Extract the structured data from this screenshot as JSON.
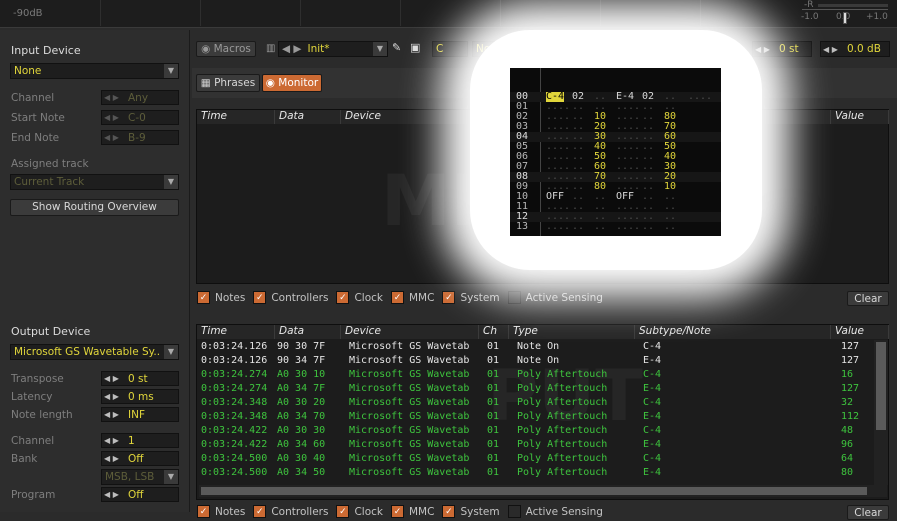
{
  "top_meter": {
    "db_label": "-90dB",
    "vu_labels": [
      "-R",
      "-L",
      "-1.0",
      "0.0",
      "+1.0"
    ]
  },
  "left_panel": {
    "input_device_title": "Input Device",
    "input_device_value": "None",
    "channel_label": "Channel",
    "channel_value": "Any",
    "start_note_label": "Start Note",
    "start_note_value": "C-0",
    "end_note_label": "End Note",
    "end_note_value": "B-9",
    "assigned_track_label": "Assigned track",
    "assigned_track_value": "Current Track",
    "routing_button": "Show Routing Overview",
    "output_device_title": "Output Device",
    "output_device_value": "Microsoft GS Wavetable Sy..",
    "transpose_label": "Transpose",
    "transpose_value": "0 st",
    "latency_label": "Latency",
    "latency_value": "0 ms",
    "note_length_label": "Note length",
    "note_length_value": "INF",
    "out_channel_label": "Channel",
    "out_channel_value": "1",
    "bank_label": "Bank",
    "bank_value": "Off",
    "bank_mode_value": "MSB, LSB",
    "program_label": "Program",
    "program_value": "Off"
  },
  "toolbar": {
    "macros_label": "Macros",
    "preset_value": "Init*",
    "key_value": "C",
    "scale_value": "No scale",
    "transpose_value": "0 st",
    "volume_value": "0.0 dB"
  },
  "tabs": {
    "phrases": "Phrases",
    "monitor": "Monitor"
  },
  "input_table": {
    "columns": [
      "Time",
      "Data",
      "Device",
      "Ch",
      "Value"
    ],
    "watermark": "MI"
  },
  "filters": {
    "items": [
      {
        "label": "Notes",
        "checked": true
      },
      {
        "label": "Controllers",
        "checked": true
      },
      {
        "label": "Clock",
        "checked": true
      },
      {
        "label": "MMC",
        "checked": true
      },
      {
        "label": "System",
        "checked": true
      },
      {
        "label": "Active Sensing",
        "checked": false
      }
    ],
    "clear_label": "Clear"
  },
  "output_table": {
    "columns": [
      "Time",
      "Data",
      "Device",
      "Ch",
      "Type",
      "Subtype/Note",
      "Value"
    ],
    "watermark": "PUT",
    "rows": [
      {
        "time": "0:03:24.126",
        "data": "90 30 7F",
        "device": "Microsoft GS Wavetab",
        "ch": "01",
        "type": "Note On",
        "sub": "C-4",
        "value": "127",
        "color": "#e6e6e6"
      },
      {
        "time": "0:03:24.126",
        "data": "90 34 7F",
        "device": "Microsoft GS Wavetab",
        "ch": "01",
        "type": "Note On",
        "sub": "E-4",
        "value": "127",
        "color": "#e6e6e6"
      },
      {
        "time": "0:03:24.274",
        "data": "A0 30 10",
        "device": "Microsoft GS Wavetab",
        "ch": "01",
        "type": "Poly Aftertouch",
        "sub": "C-4",
        "value": "16",
        "color": "#3ec43e"
      },
      {
        "time": "0:03:24.274",
        "data": "A0 34 7F",
        "device": "Microsoft GS Wavetab",
        "ch": "01",
        "type": "Poly Aftertouch",
        "sub": "E-4",
        "value": "127",
        "color": "#3ec43e"
      },
      {
        "time": "0:03:24.348",
        "data": "A0 30 20",
        "device": "Microsoft GS Wavetab",
        "ch": "01",
        "type": "Poly Aftertouch",
        "sub": "C-4",
        "value": "32",
        "color": "#3ec43e"
      },
      {
        "time": "0:03:24.348",
        "data": "A0 34 70",
        "device": "Microsoft GS Wavetab",
        "ch": "01",
        "type": "Poly Aftertouch",
        "sub": "E-4",
        "value": "112",
        "color": "#3ec43e"
      },
      {
        "time": "0:03:24.422",
        "data": "A0 30 30",
        "device": "Microsoft GS Wavetab",
        "ch": "01",
        "type": "Poly Aftertouch",
        "sub": "C-4",
        "value": "48",
        "color": "#3ec43e"
      },
      {
        "time": "0:03:24.422",
        "data": "A0 34 60",
        "device": "Microsoft GS Wavetab",
        "ch": "01",
        "type": "Poly Aftertouch",
        "sub": "E-4",
        "value": "96",
        "color": "#3ec43e"
      },
      {
        "time": "0:03:24.500",
        "data": "A0 30 40",
        "device": "Microsoft GS Wavetab",
        "ch": "01",
        "type": "Poly Aftertouch",
        "sub": "C-4",
        "value": "64",
        "color": "#3ec43e"
      },
      {
        "time": "0:03:24.500",
        "data": "A0 34 50",
        "device": "Microsoft GS Wavetab",
        "ch": "01",
        "type": "Poly Aftertouch",
        "sub": "E-4",
        "value": "80",
        "color": "#3ec43e"
      }
    ]
  },
  "bottom_clear_label": "Clear",
  "tracker": {
    "rows": [
      {
        "n": "00",
        "a": "C-4",
        "b": "02",
        "c": "..",
        "d": "E-4",
        "e": "02",
        "f": "..",
        "g": "....",
        "hl": true
      },
      {
        "n": "01",
        "a": "....",
        "b": "..",
        "c": "..",
        "d": "....",
        "e": "..",
        "f": "..",
        "g": ""
      },
      {
        "n": "02",
        "a": "....",
        "b": "..",
        "c": "10",
        "d": "....",
        "e": "..",
        "f": "80",
        "g": ""
      },
      {
        "n": "03",
        "a": "....",
        "b": "..",
        "c": "20",
        "d": "....",
        "e": "..",
        "f": "70",
        "g": ""
      },
      {
        "n": "04",
        "a": "....",
        "b": "..",
        "c": "30",
        "d": "....",
        "e": "..",
        "f": "60",
        "g": ""
      },
      {
        "n": "05",
        "a": "....",
        "b": "..",
        "c": "40",
        "d": "....",
        "e": "..",
        "f": "50",
        "g": ""
      },
      {
        "n": "06",
        "a": "....",
        "b": "..",
        "c": "50",
        "d": "....",
        "e": "..",
        "f": "40",
        "g": ""
      },
      {
        "n": "07",
        "a": "....",
        "b": "..",
        "c": "60",
        "d": "....",
        "e": "..",
        "f": "30",
        "g": ""
      },
      {
        "n": "08",
        "a": "....",
        "b": "..",
        "c": "70",
        "d": "....",
        "e": "..",
        "f": "20",
        "g": ""
      },
      {
        "n": "09",
        "a": "....",
        "b": "..",
        "c": "80",
        "d": "....",
        "e": "..",
        "f": "10",
        "g": ""
      },
      {
        "n": "10",
        "a": "OFF",
        "b": "..",
        "c": "..",
        "d": "OFF",
        "e": "..",
        "f": "..",
        "g": ""
      },
      {
        "n": "11",
        "a": "....",
        "b": "..",
        "c": "..",
        "d": "....",
        "e": "..",
        "f": "..",
        "g": ""
      },
      {
        "n": "12",
        "a": "....",
        "b": "..",
        "c": "..",
        "d": "....",
        "e": "..",
        "f": "..",
        "g": ""
      },
      {
        "n": "13",
        "a": "....",
        "b": "..",
        "c": "..",
        "d": "....",
        "e": "..",
        "f": "..",
        "g": ""
      }
    ]
  },
  "colors": {
    "accent": "#cc6a33",
    "value_yellow": "#e1d63b",
    "note_green": "#3ec43e",
    "panel": "#2d2d2d"
  }
}
